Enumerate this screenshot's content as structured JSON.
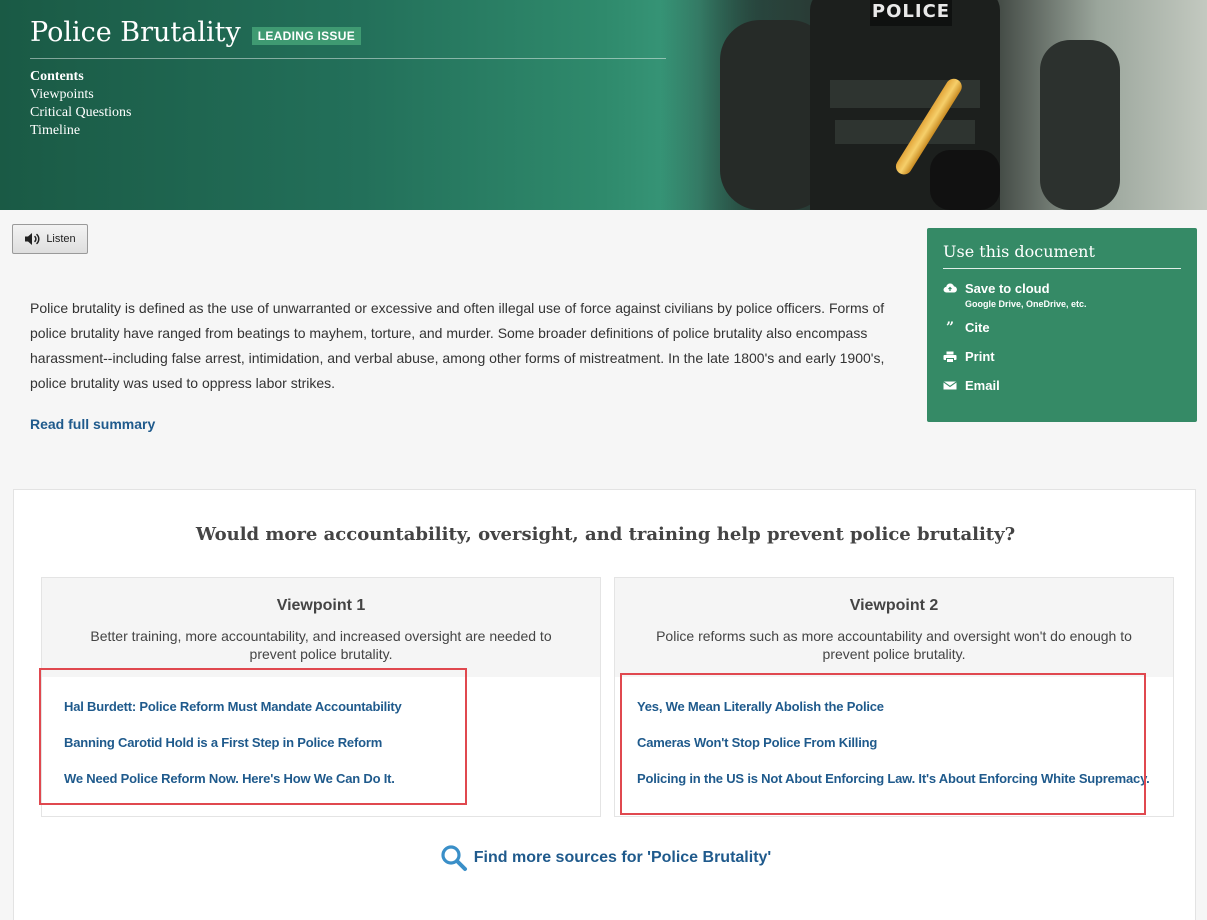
{
  "hero": {
    "title": "Police Brutality",
    "badge": "LEADING ISSUE",
    "nav": [
      "Contents",
      "Viewpoints",
      "Critical Questions",
      "Timeline"
    ],
    "photo_patch": "POLICE"
  },
  "listen": {
    "label": "Listen",
    "icon": "speaker-icon"
  },
  "summary": {
    "text": "Police brutality is defined as the use of unwarranted or excessive and often illegal use of force against civilians by police officers. Forms of police brutality have ranged from beatings to mayhem, torture, and murder. Some broader definitions of police brutality also encompass harassment--including false arrest, intimidation, and verbal abuse, among other forms of mistreatment. In the late 1800's and early 1900's, police brutality was used to oppress labor strikes.",
    "read_full": "Read full summary"
  },
  "use_document": {
    "title": "Use this document",
    "actions": [
      {
        "label": "Save to cloud",
        "sub": "Google Drive, OneDrive, etc.",
        "icon": "cloud-upload-icon"
      },
      {
        "label": "Cite",
        "icon": "quote-icon"
      },
      {
        "label": "Print",
        "icon": "printer-icon"
      },
      {
        "label": "Email",
        "icon": "envelope-icon"
      }
    ]
  },
  "question": "Would more accountability, oversight, and training help prevent police brutality?",
  "viewpoints": [
    {
      "title": "Viewpoint 1",
      "desc": "Better training, more accountability, and increased oversight are needed to prevent police brutality.",
      "links": [
        "Hal Burdett: Police Reform Must Mandate Accountability",
        "Banning Carotid Hold is a First Step in Police Reform",
        "We Need Police Reform Now. Here's How We Can Do It."
      ]
    },
    {
      "title": "Viewpoint 2",
      "desc": "Police reforms such as more accountability and oversight won't do enough to prevent police brutality.",
      "links": [
        "Yes, We Mean Literally Abolish the Police",
        "Cameras Won't Stop Police From Killing",
        "Policing in the US is Not About Enforcing Law. It's About Enforcing White Supremacy."
      ]
    }
  ],
  "find_more": {
    "label": "Find more sources for 'Police Brutality'",
    "icon": "magnifier-icon"
  },
  "colors": {
    "brand_green": "#358a66",
    "link_blue": "#1f5a8c",
    "highlight_red": "#e0484f"
  }
}
